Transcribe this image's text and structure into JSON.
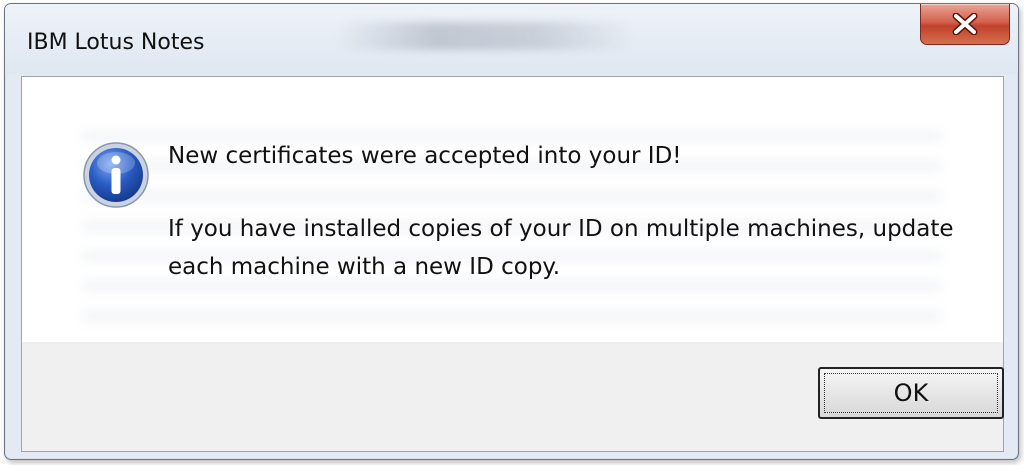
{
  "window": {
    "title": "IBM Lotus Notes",
    "close_icon": "close-x-icon"
  },
  "message": {
    "icon": "info-icon",
    "line1": "New certificates were accepted into your ID!",
    "line2": "If you have installed copies of your ID on multiple machines, update each machine with a new ID copy."
  },
  "buttons": {
    "ok_label": "OK"
  },
  "colors": {
    "close_button": "#c8452f",
    "info_icon_blue": "#1f4fb5",
    "dialog_background": "#f0f0f0",
    "message_background": "#ffffff"
  }
}
